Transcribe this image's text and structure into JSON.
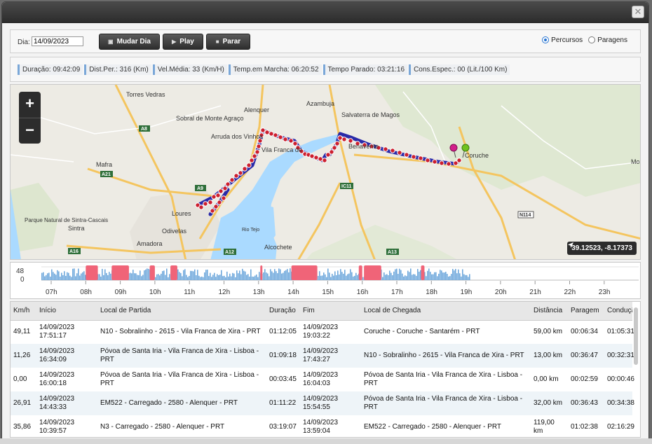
{
  "window": {
    "close_symbol": "✕"
  },
  "toolbar": {
    "day_label": "Dia:",
    "day_value": "14/09/2023",
    "buttons": [
      {
        "label": "Mudar Dia",
        "icon": "calendar-icon",
        "glyph": "🗓"
      },
      {
        "label": "Play",
        "icon": "play-icon",
        "glyph": "▶"
      },
      {
        "label": "Parar",
        "icon": "stop-icon",
        "glyph": "■"
      }
    ],
    "view_options": [
      {
        "label": "Percursos",
        "selected": true
      },
      {
        "label": "Paragens",
        "selected": false
      }
    ]
  },
  "stats": [
    "Duração: 09:42:09",
    "Dist.Per.: 316 (Km)",
    "Vel.Média: 33 (Km/H)",
    "Temp.em Marcha: 06:20:52",
    "Tempo Parado: 03:21:16",
    "Cons.Espec.: 00 (Lit./100 Km)"
  ],
  "map": {
    "zoom_in": "+",
    "zoom_out": "−",
    "coordinates": "39.12523, -8.17373",
    "place_labels": [
      "Torres Vedras",
      "Alenquer",
      "Azambuja",
      "Salvaterra de Magos",
      "Sobral de Monte Agraço",
      "Arruda dos Vinhos",
      "Vila Franca de",
      "Benavente",
      "Coruche",
      "Mafra",
      "Loures",
      "Odivelas",
      "Amadora",
      "Sintra",
      "Parque Natural de Sintra-Cascais",
      "Rio Tejo",
      "Alcochete",
      "Mora"
    ],
    "road_labels": [
      "A8",
      "A21",
      "A9",
      "A16",
      "A12",
      "A13",
      "IC11",
      "N114"
    ],
    "route_color": "#2a2aa8",
    "point_color": "#cc1f2f"
  },
  "timeline": {
    "y_labels": [
      "48",
      "0"
    ],
    "hours": [
      "07h",
      "08h",
      "09h",
      "10h",
      "11h",
      "12h",
      "13h",
      "14h",
      "15h",
      "16h",
      "17h",
      "18h",
      "19h",
      "20h",
      "21h",
      "22h",
      "23h"
    ],
    "speed_color": "#6fa8dc",
    "stop_color": "#f06478"
  },
  "table": {
    "columns": [
      "Km/h",
      "Início",
      "Local de Partida",
      "Duração",
      "Fim",
      "Local de Chegada",
      "Distância",
      "Paragem",
      "Condução"
    ],
    "rows": [
      {
        "kmh": "49,11",
        "start": "14/09/2023 17:51:17",
        "from": "N10 - Sobralinho - 2615 - Vila Franca de Xira - PRT",
        "duration": "01:12:05",
        "end": "14/09/2023 19:03:22",
        "to": "Coruche - Coruche - Santarém - PRT",
        "distance": "59,00 km",
        "stop": "00:06:34",
        "driving": "01:05:31"
      },
      {
        "kmh": "11,26",
        "start": "14/09/2023 16:34:09",
        "from": "Póvoa de Santa Iria - Vila Franca de Xira - Lisboa - PRT",
        "duration": "01:09:18",
        "end": "14/09/2023 17:43:27",
        "to": "N10 - Sobralinho - 2615 - Vila Franca de Xira - PRT",
        "distance": "13,00 km",
        "stop": "00:36:47",
        "driving": "00:32:31"
      },
      {
        "kmh": "0,00",
        "start": "14/09/2023 16:00:18",
        "from": "Póvoa de Santa Iria - Vila Franca de Xira - Lisboa - PRT",
        "duration": "00:03:45",
        "end": "14/09/2023 16:04:03",
        "to": "Póvoa de Santa Iria - Vila Franca de Xira - Lisboa - PRT",
        "distance": "0,00 km",
        "stop": "00:02:59",
        "driving": "00:00:46"
      },
      {
        "kmh": "26,91",
        "start": "14/09/2023 14:43:33",
        "from": "EM522 - Carregado - 2580 - Alenquer - PRT",
        "duration": "01:11:22",
        "end": "14/09/2023 15:54:55",
        "to": "Póvoa de Santa Iria - Vila Franca de Xira - Lisboa - PRT",
        "distance": "32,00 km",
        "stop": "00:36:43",
        "driving": "00:34:38"
      },
      {
        "kmh": "35,86",
        "start": "14/09/2023 10:39:57",
        "from": "N3 - Carregado - 2580 - Alenquer - PRT",
        "duration": "03:19:07",
        "end": "14/09/2023 13:59:04",
        "to": "EM522 - Carregado - 2580 - Alenquer - PRT",
        "distance": "119,00 km",
        "stop": "01:02:38",
        "driving": "02:16:29"
      }
    ]
  }
}
